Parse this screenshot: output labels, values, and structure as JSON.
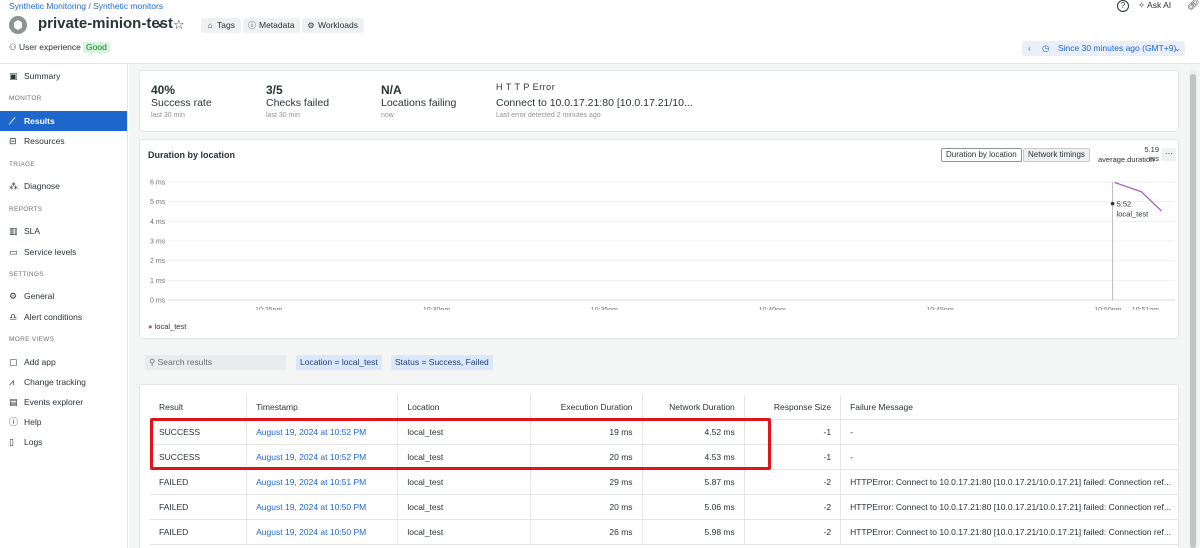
{
  "breadcrumb": {
    "first": "Synthetic Monitoring",
    "sep": " / ",
    "second": "Synthetic monitors"
  },
  "header": {
    "title": "private-minion-test",
    "tags": "Tags",
    "metadata": "Metadata",
    "workloads": "Workloads",
    "ux_label": "User experience",
    "ux_status": "Good",
    "ask_ai": "Ask AI",
    "time_range": "Since 30 minutes ago (GMT+9)"
  },
  "sidebar": {
    "summary": "Summary",
    "sec_monitor": "MONITOR",
    "results": "Results",
    "resources": "Resources",
    "sec_triage": "TRIAGE",
    "diagnose": "Diagnose",
    "sec_reports": "REPORTS",
    "sla": "SLA",
    "service_levels": "Service levels",
    "sec_settings": "SETTINGS",
    "general": "General",
    "alert_conditions": "Alert conditions",
    "sec_more": "MORE VIEWS",
    "add_app": "Add app",
    "change_tracking": "Change tracking",
    "events_explorer": "Events explorer",
    "help": "Help",
    "logs": "Logs"
  },
  "kpis": [
    {
      "value": "40%",
      "label": "Success rate",
      "sub": "last 30 min"
    },
    {
      "value": "3/5",
      "label": "Checks failed",
      "sub": "last 30 min"
    },
    {
      "value": "N/A",
      "label": "Locations failing",
      "sub": "now"
    }
  ],
  "error": {
    "title": "H T T P Error",
    "message": "Connect to 10.0.17.21:80 [10.0.17.21/10...",
    "sub": "Last error detected 2 minutes ago"
  },
  "chart_panel": {
    "title": "Duration by location",
    "toggle_1": "Duration by location",
    "toggle_2": "Network timings",
    "stat_value": "5.19 ms",
    "stat_label": "average.duration",
    "more": "···",
    "tooltip_time": "5:52",
    "tooltip_loc": "local_test",
    "legend": "local_test"
  },
  "chart_data": {
    "type": "line",
    "y_ticks": [
      "6 ms",
      "5 ms",
      "4 ms",
      "3 ms",
      "2 ms",
      "1 ms",
      "0 ms"
    ],
    "x_ticks": [
      "10:25pm",
      "10:30pm",
      "10:35pm",
      "10:40pm",
      "10:45pm",
      "10:50pm",
      "10:51pm"
    ],
    "ylim": [
      0,
      6
    ],
    "series": [
      {
        "name": "local_test",
        "color": "#9b59b6",
        "points": [
          [
            50.2,
            5.98
          ],
          [
            51.0,
            5.5
          ],
          [
            51.6,
            4.52
          ]
        ]
      }
    ]
  },
  "filters": {
    "search_placeholder": "Search results",
    "location": "Location  =  local_test",
    "status": "Status  =  Success, Failed"
  },
  "table": {
    "headers": [
      "Result",
      "Timestamp",
      "Location",
      "Execution Duration",
      "Network Duration",
      "Response Size",
      "Failure Message"
    ],
    "rows": [
      [
        "SUCCESS",
        "August 19, 2024 at 10:52 PM",
        "local_test",
        "19 ms",
        "4.52 ms",
        "-1",
        "-"
      ],
      [
        "SUCCESS",
        "August 19, 2024 at 10:52 PM",
        "local_test",
        "20 ms",
        "4.53 ms",
        "-1",
        "-"
      ],
      [
        "FAILED",
        "August 19, 2024 at 10:51 PM",
        "local_test",
        "29 ms",
        "5.87 ms",
        "-2",
        "HTTPError: Connect to 10.0.17.21:80 [10.0.17.21/10.0.17.21] failed: Connection ref..."
      ],
      [
        "FAILED",
        "August 19, 2024 at 10:50 PM",
        "local_test",
        "20 ms",
        "5.06 ms",
        "-2",
        "HTTPError: Connect to 10.0.17.21:80 [10.0.17.21/10.0.17.21] failed: Connection ref..."
      ],
      [
        "FAILED",
        "August 19, 2024 at 10:50 PM",
        "local_test",
        "26 ms",
        "5.98 ms",
        "-2",
        "HTTPError: Connect to 10.0.17.21:80 [10.0.17.21/10.0.17.21] failed: Connection ref..."
      ]
    ]
  }
}
